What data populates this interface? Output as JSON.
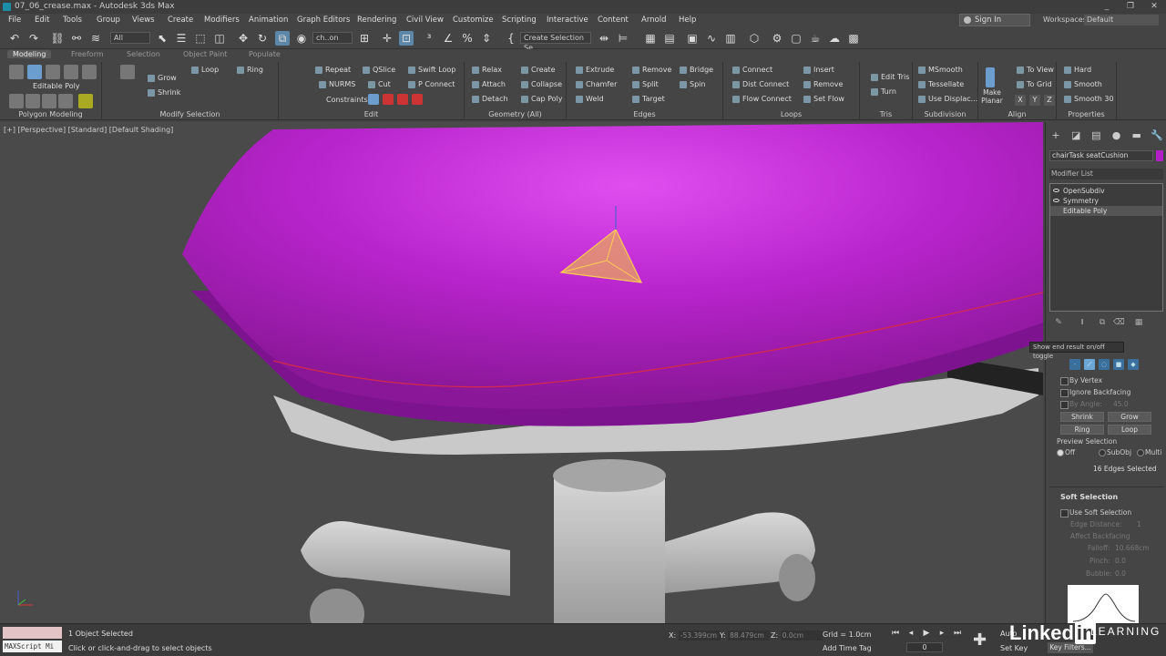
{
  "window": {
    "title": "07_06_crease.max - Autodesk 3ds Max",
    "controls": [
      "_",
      "❐",
      "✕"
    ]
  },
  "menu": [
    "File",
    "Edit",
    "Tools",
    "Group",
    "Views",
    "Create",
    "Modifiers",
    "Animation",
    "Graph Editors",
    "Rendering",
    "Civil View",
    "Customize",
    "Scripting",
    "Interactive",
    "Content",
    "Arnold",
    "Help"
  ],
  "account": {
    "signin": "Sign In",
    "workspaces_label": "Workspaces:",
    "workspace": "Default"
  },
  "toolbar": {
    "filter": "All",
    "ref_coord": "ch..on",
    "named_sel": "Create Selection Se"
  },
  "ribbon": {
    "tabs": [
      "Modeling",
      "Freeform",
      "Selection",
      "Object Paint",
      "Populate"
    ],
    "active_tab": "Modeling",
    "groups": {
      "polygon_modeling": {
        "label": "Polygon Modeling",
        "mode": "Editable Poly"
      },
      "modify_selection": {
        "label": "Modify Selection",
        "grow": "Grow",
        "shrink": "Shrink",
        "loop": "Loop",
        "ring": "Ring"
      },
      "edit": {
        "label": "Edit",
        "repeat": "Repeat",
        "qslice": "QSlice",
        "swift_loop": "Swift Loop",
        "nurms": "NURMS",
        "cut": "Cut",
        "pconnect": "P Connect",
        "constraints": "Constraints:"
      },
      "geometry": {
        "label": "Geometry (All)",
        "relax": "Relax",
        "create": "Create",
        "attach": "Attach",
        "collapse": "Collapse",
        "detach": "Detach",
        "cap_poly": "Cap Poly"
      },
      "edges": {
        "label": "Edges",
        "extrude": "Extrude",
        "remove": "Remove",
        "bridge": "Bridge",
        "chamfer": "Chamfer",
        "split": "Split",
        "spin": "Spin",
        "weld": "Weld",
        "target": "Target"
      },
      "loops": {
        "label": "Loops",
        "connect": "Connect",
        "dist_connect": "Dist Connect",
        "flow_connect": "Flow Connect",
        "insert": "Insert",
        "remove": "Remove",
        "set_flow": "Set Flow"
      },
      "tris": {
        "label": "Tris",
        "edit_tris": "Edit Tris",
        "turn": "Turn"
      },
      "subdivision": {
        "label": "Subdivision",
        "msmooth": "MSmooth",
        "tessellate": "Tessellate",
        "use_displac": "Use Displac..."
      },
      "align": {
        "label": "Align",
        "make_planar": "Make Planar",
        "to_view": "To View",
        "to_grid": "To Grid",
        "x": "X",
        "y": "Y",
        "z": "Z"
      },
      "properties": {
        "label": "Properties",
        "hard": "Hard",
        "smooth": "Smooth",
        "smooth30": "Smooth 30"
      }
    }
  },
  "viewport": {
    "label": "[+] [Perspective] [Standard] [Default Shading]",
    "object_color": "#b21fc6",
    "crease_color": "#d42a4a"
  },
  "command_panel": {
    "object_name": "chairTask seatCushion",
    "modifier_list": "Modifier List",
    "stack": [
      "OpenSubdiv",
      "Symmetry",
      "Editable Poly"
    ],
    "tooltip": "Show end result on/off toggle",
    "selection": {
      "by_vertex": "By Vertex",
      "ignore_backfacing": "Ignore Backfacing",
      "by_angle": "By Angle:",
      "by_angle_value": "45.0",
      "shrink": "Shrink",
      "grow": "Grow",
      "ring": "Ring",
      "loop": "Loop",
      "preview_selection": "Preview Selection",
      "off": "Off",
      "subobj": "SubObj",
      "multi": "Multi",
      "status": "16 Edges Selected"
    },
    "soft_selection": {
      "title": "Soft Selection",
      "use_soft_selection": "Use Soft Selection",
      "edge_distance": "Edge Distance:",
      "edge_distance_value": "1",
      "affect_backfacing": "Affect Backfacing",
      "falloff": "Falloff:",
      "falloff_value": "10.668cm",
      "pinch": "Pinch:",
      "pinch_value": "0.0",
      "bubble": "Bubble:",
      "bubble_value": "0.0"
    }
  },
  "status": {
    "selected": "1 Object Selected",
    "hint": "Click or click-and-drag to select objects",
    "maxscript": "MAXScript Mi",
    "x_label": "X:",
    "x": "-53.399cm",
    "y_label": "Y:",
    "y": "88.479cm",
    "z_label": "Z:",
    "z": "0.0cm",
    "grid": "Grid = 1.0cm",
    "add_time_tag": "Add Time Tag",
    "frame": "0",
    "auto": "Auto",
    "set_key": "Set Key",
    "key_filters": "Key Filters..."
  },
  "branding": {
    "linkedin": "Linked",
    "in": "in",
    "learning": "LEARNING"
  }
}
